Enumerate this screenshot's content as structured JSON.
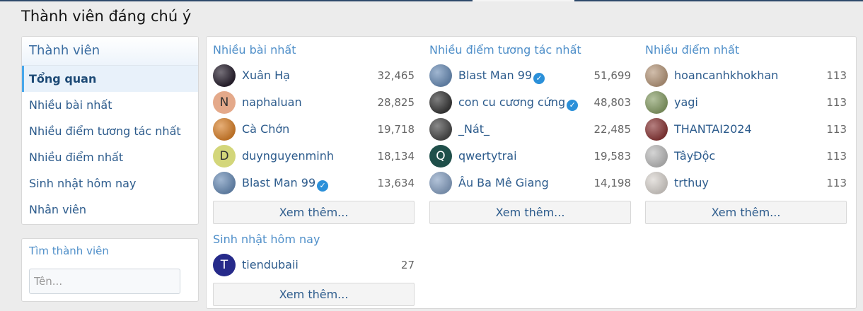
{
  "page": {
    "title": "Thành viên đáng chú ý"
  },
  "sidebar": {
    "heading": "Thành viên",
    "items": [
      {
        "label": "Tổng quan",
        "active": true
      },
      {
        "label": "Nhiều bài nhất",
        "active": false
      },
      {
        "label": "Nhiều điểm tương tác nhất",
        "active": false
      },
      {
        "label": "Nhiều điểm nhất",
        "active": false
      },
      {
        "label": "Sinh nhật hôm nay",
        "active": false
      },
      {
        "label": "Nhân viên",
        "active": false
      }
    ]
  },
  "search": {
    "title": "Tìm thành viên",
    "placeholder": "Tên..."
  },
  "sections": {
    "most_posts": {
      "title": "Nhiều bài nhất",
      "more": "Xem thêm...",
      "members": [
        {
          "name": "Xuân Hạ",
          "count": "32,465",
          "avatar_icon": "photo-avatar-dark",
          "avatar_color": "#2a2230"
        },
        {
          "name": "naphaluan",
          "count": "28,825",
          "avatar_icon": "letter-avatar",
          "letter": "N",
          "avatar_color": "#e4a98a"
        },
        {
          "name": "Cà Chớn",
          "count": "19,718",
          "avatar_icon": "photo-avatar-dragon",
          "avatar_color": "#d9832e"
        },
        {
          "name": "duynguyenminh",
          "count": "18,134",
          "avatar_icon": "letter-avatar",
          "letter": "D",
          "avatar_color": "#d3d67a"
        },
        {
          "name": "Blast Man 99",
          "count": "13,634",
          "avatar_icon": "photo-avatar-car",
          "avatar_color": "#6d8fb8",
          "verified": true
        }
      ]
    },
    "most_reactions": {
      "title": "Nhiều điểm tương tác nhất",
      "more": "Xem thêm...",
      "members": [
        {
          "name": "Blast Man 99",
          "count": "51,699",
          "avatar_icon": "photo-avatar-car",
          "avatar_color": "#6d8fb8",
          "verified": true
        },
        {
          "name": "con cu cương cứng",
          "count": "48,803",
          "avatar_icon": "photo-avatar-dark",
          "avatar_color": "#3a3a3a",
          "verified": true
        },
        {
          "name": "_Nát_",
          "count": "22,485",
          "avatar_icon": "photo-avatar-gray",
          "avatar_color": "#4b4b4b"
        },
        {
          "name": "qwertytrai",
          "count": "19,583",
          "avatar_icon": "letter-avatar",
          "letter": "Q",
          "avatar_color": "#1f4f4a"
        },
        {
          "name": "Âu Ba Mê Giang",
          "count": "14,198",
          "avatar_icon": "photo-avatar-player",
          "avatar_color": "#8aa3c4"
        }
      ]
    },
    "most_points": {
      "title": "Nhiều điểm nhất",
      "more": "Xem thêm...",
      "members": [
        {
          "name": "hoancanhkhokhan",
          "count": "113",
          "avatar_icon": "photo-avatar-skin",
          "avatar_color": "#b89a7e"
        },
        {
          "name": "yagi",
          "count": "113",
          "avatar_icon": "photo-avatar-green",
          "avatar_color": "#8aa06a"
        },
        {
          "name": "THANTAI2024",
          "count": "113",
          "avatar_icon": "photo-avatar-red",
          "avatar_color": "#8c3b3b"
        },
        {
          "name": "TâyĐộc",
          "count": "113",
          "avatar_icon": "photo-avatar-light",
          "avatar_color": "#bdbdbd"
        },
        {
          "name": "trthuy",
          "count": "113",
          "avatar_icon": "photo-avatar-white",
          "avatar_color": "#d9d4cf"
        }
      ]
    },
    "birthday_today": {
      "title": "Sinh nhật hôm nay",
      "more": "Xem thêm...",
      "members": [
        {
          "name": "tiendubaii",
          "count": "27",
          "avatar_icon": "letter-avatar",
          "letter": "T",
          "avatar_color": "#262a8a"
        }
      ]
    }
  }
}
